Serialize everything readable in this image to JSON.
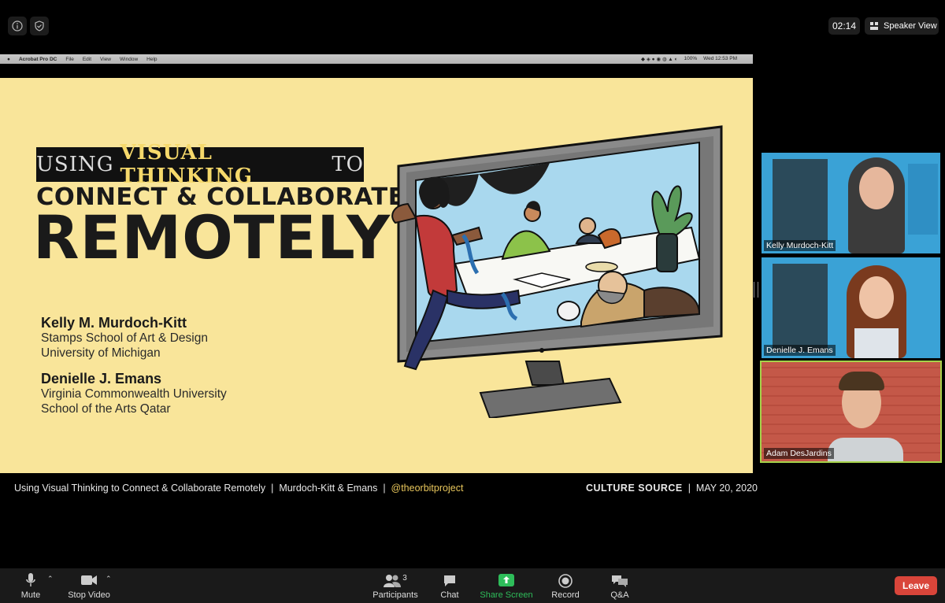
{
  "top": {
    "timer": "02:14",
    "speaker_view_label": "Speaker View"
  },
  "menubar": {
    "app": "Acrobat Pro DC",
    "items": [
      "File",
      "Edit",
      "View",
      "Window",
      "Help"
    ],
    "battery": "100%",
    "clock": "Wed 12:53 PM"
  },
  "slide": {
    "title_line1_pre": "USING",
    "title_line1_bold": "VISUAL THINKING",
    "title_line1_post": "TO",
    "title_line2": "CONNECT & COLLABORATE",
    "title_line3": "REMOTELY",
    "author1": {
      "name": "Kelly M. Murdoch-Kitt",
      "line1": "Stamps School of Art & Design",
      "line2": "University of Michigan"
    },
    "author2": {
      "name": "Denielle J. Emans",
      "line1": "Virginia Commonwealth University",
      "line2": "School of the Arts Qatar"
    }
  },
  "caption": {
    "left_title": "Using Visual Thinking to Connect & Collaborate Remotely",
    "sep": "|",
    "authors": "Murdoch-Kitt & Emans",
    "handle": "@theorbitproject",
    "event": "CULTURE SOURCE",
    "date": "MAY 20, 2020"
  },
  "participants": [
    {
      "name": "Kelly Murdoch-Kitt"
    },
    {
      "name": "Denielle J. Emans"
    },
    {
      "name": "Adam DesJardins"
    }
  ],
  "toolbar": {
    "mute": "Mute",
    "stop_video": "Stop Video",
    "participants": "Participants",
    "participants_count": "3",
    "chat": "Chat",
    "share_screen": "Share Screen",
    "record": "Record",
    "qa": "Q&A",
    "leave": "Leave"
  },
  "colors": {
    "slide_bg": "#f9e59a",
    "accent_yellow": "#f6d96b",
    "share_green": "#2ebd5a",
    "leave_red": "#d9453a"
  }
}
